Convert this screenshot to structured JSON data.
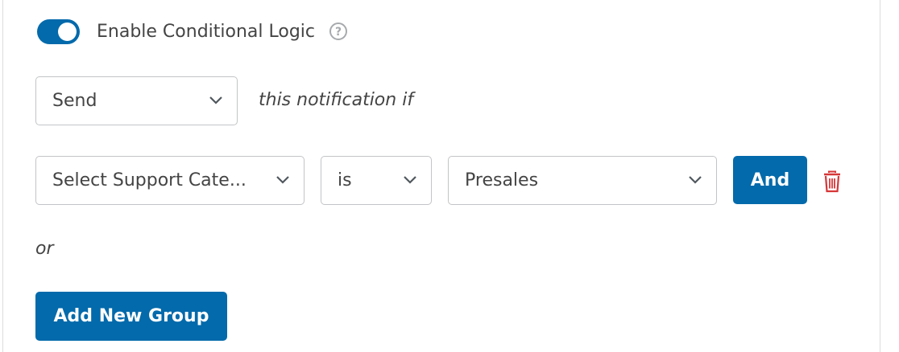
{
  "conditional_logic": {
    "enabled": true,
    "label": "Enable Conditional Logic",
    "help_icon": "question-circle-icon"
  },
  "action_row": {
    "action_select_value": "Send",
    "suffix_text": "this notification if"
  },
  "rule": {
    "field_select_value": "Select Support Cate...",
    "operator_select_value": "is",
    "value_select_value": "Presales",
    "and_button_label": "And",
    "delete_icon": "trash-icon"
  },
  "or_text": "or",
  "add_group_button_label": "Add New Group",
  "colors": {
    "accent": "#036aab",
    "delete": "#d63638",
    "border": "#c3c4c7"
  }
}
